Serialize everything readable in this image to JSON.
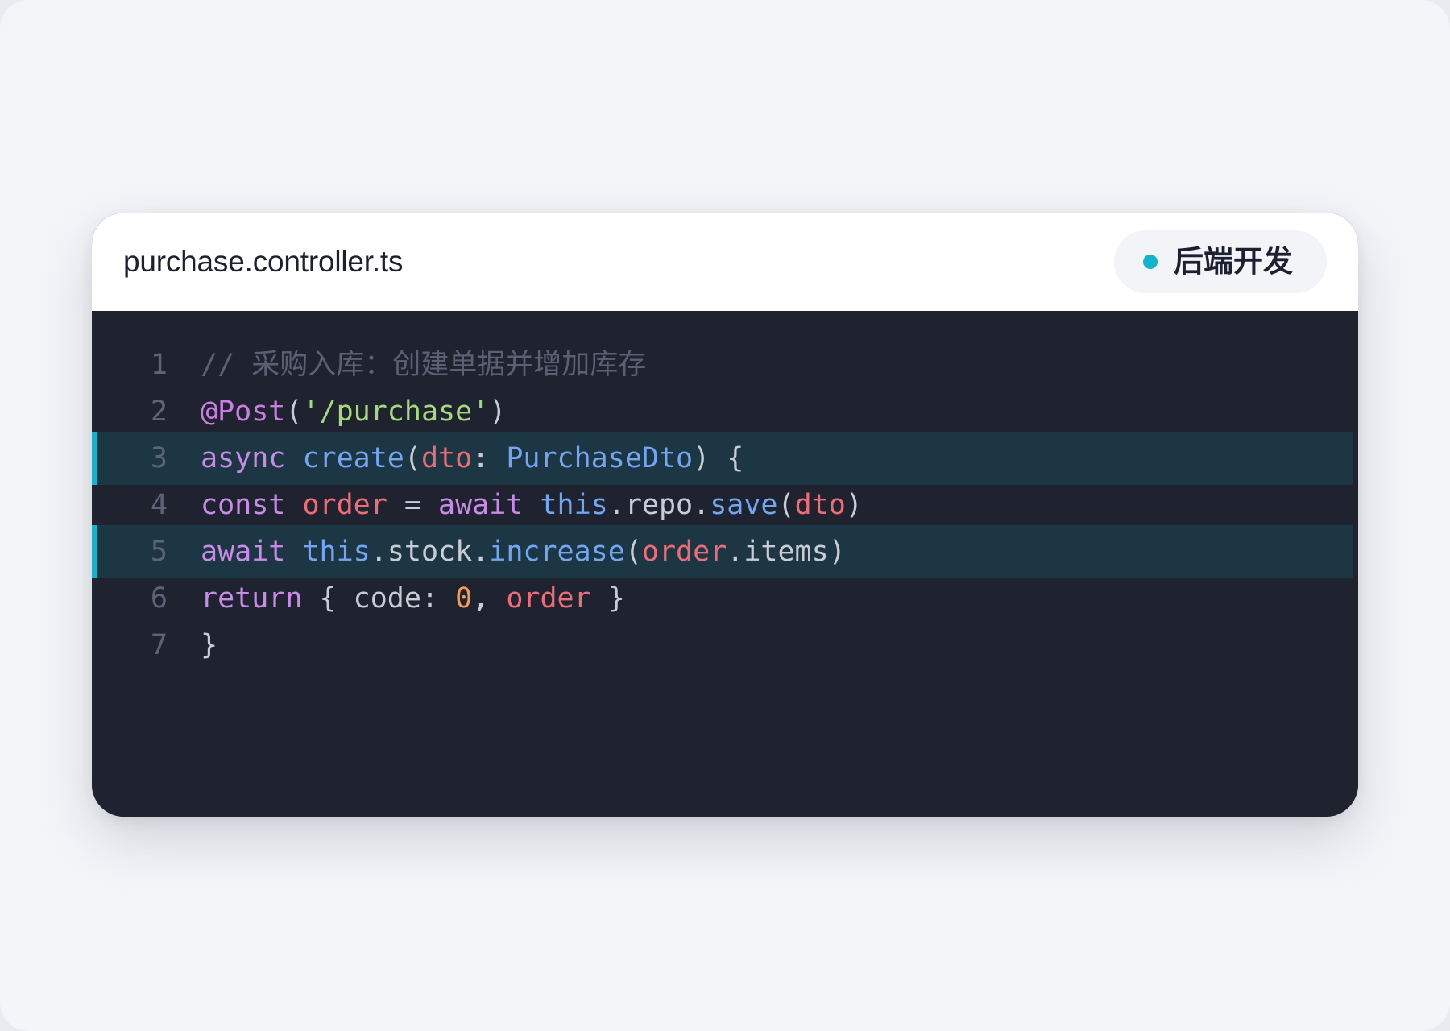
{
  "file": {
    "name": "purchase.controller.ts"
  },
  "badge": {
    "label": "后端开发",
    "dot_color": "#12b3cf"
  },
  "editor": {
    "highlighted_lines": [
      3,
      5
    ],
    "lines": [
      {
        "number": "1",
        "highlighted": false,
        "tokens": [
          {
            "type": "comment",
            "text": "// 采购入库：创建单据并增加库存"
          }
        ]
      },
      {
        "number": "2",
        "highlighted": false,
        "tokens": [
          {
            "type": "decorator",
            "text": "@Post"
          },
          {
            "type": "punct",
            "text": "("
          },
          {
            "type": "string",
            "text": "'/purchase'"
          },
          {
            "type": "punct",
            "text": ")"
          }
        ]
      },
      {
        "number": "3",
        "highlighted": true,
        "tokens": [
          {
            "type": "keyword",
            "text": "async"
          },
          {
            "type": "plain",
            "text": " "
          },
          {
            "type": "function",
            "text": "create"
          },
          {
            "type": "punct",
            "text": "("
          },
          {
            "type": "param",
            "text": "dto"
          },
          {
            "type": "punct",
            "text": ": "
          },
          {
            "type": "type",
            "text": "PurchaseDto"
          },
          {
            "type": "punct",
            "text": ") {"
          }
        ]
      },
      {
        "number": "4",
        "highlighted": false,
        "tokens": [
          {
            "type": "keyword",
            "text": "const"
          },
          {
            "type": "plain",
            "text": " "
          },
          {
            "type": "param",
            "text": "order"
          },
          {
            "type": "punct",
            "text": " = "
          },
          {
            "type": "keyword",
            "text": "await"
          },
          {
            "type": "plain",
            "text": " "
          },
          {
            "type": "function",
            "text": "this"
          },
          {
            "type": "punct",
            "text": "."
          },
          {
            "type": "plain",
            "text": "repo"
          },
          {
            "type": "punct",
            "text": "."
          },
          {
            "type": "function",
            "text": "save"
          },
          {
            "type": "punct",
            "text": "("
          },
          {
            "type": "param",
            "text": "dto"
          },
          {
            "type": "punct",
            "text": ")"
          }
        ]
      },
      {
        "number": "5",
        "highlighted": true,
        "tokens": [
          {
            "type": "keyword",
            "text": "await"
          },
          {
            "type": "plain",
            "text": " "
          },
          {
            "type": "function",
            "text": "this"
          },
          {
            "type": "punct",
            "text": "."
          },
          {
            "type": "plain",
            "text": "stock"
          },
          {
            "type": "punct",
            "text": "."
          },
          {
            "type": "function",
            "text": "increase"
          },
          {
            "type": "punct",
            "text": "("
          },
          {
            "type": "param",
            "text": "order"
          },
          {
            "type": "punct",
            "text": "."
          },
          {
            "type": "plain",
            "text": "items"
          },
          {
            "type": "punct",
            "text": ")"
          }
        ]
      },
      {
        "number": "6",
        "highlighted": false,
        "tokens": [
          {
            "type": "keyword",
            "text": "return"
          },
          {
            "type": "punct",
            "text": " { "
          },
          {
            "type": "plain",
            "text": "code"
          },
          {
            "type": "punct",
            "text": ": "
          },
          {
            "type": "number",
            "text": "0"
          },
          {
            "type": "punct",
            "text": ", "
          },
          {
            "type": "param",
            "text": "order"
          },
          {
            "type": "punct",
            "text": " }"
          }
        ]
      },
      {
        "number": "7",
        "highlighted": false,
        "tokens": [
          {
            "type": "punct",
            "text": "}"
          }
        ]
      }
    ]
  }
}
